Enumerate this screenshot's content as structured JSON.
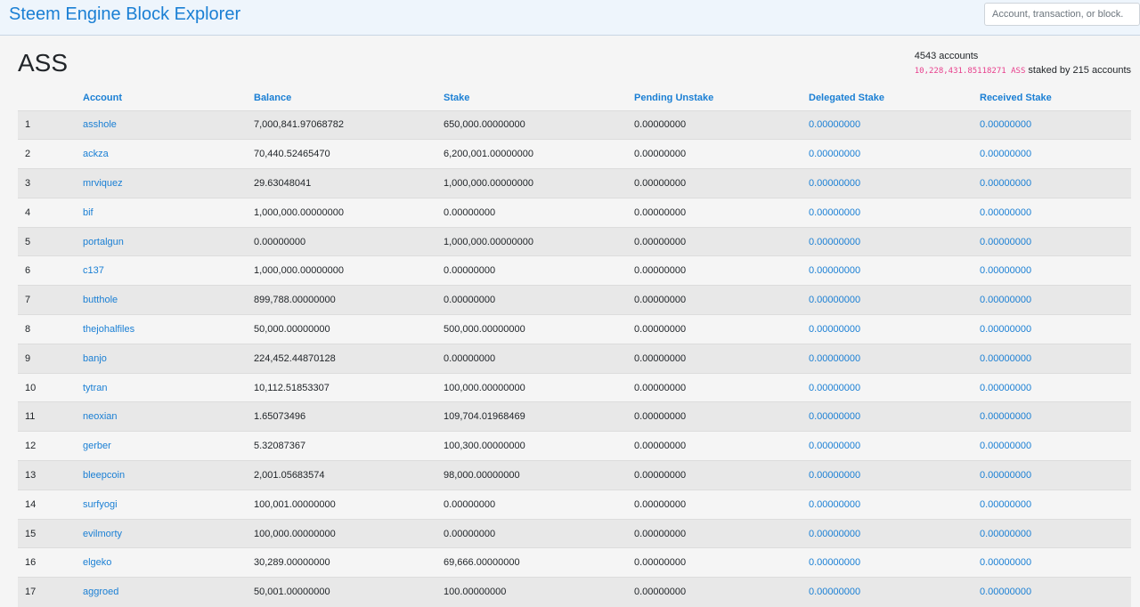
{
  "header": {
    "brand": "Steem Engine Block Explorer",
    "search_placeholder": "Account, transaction, or block."
  },
  "token": {
    "symbol": "ASS",
    "accounts_text": "4543 accounts",
    "staked_amount": "10,228,431.85118271 ASS",
    "staked_suffix": "staked by 215 accounts"
  },
  "colors": {
    "link": "#1a7fd4",
    "code": "#e83e8c"
  },
  "table": {
    "columns": [
      "",
      "Account",
      "Balance",
      "Stake",
      "Pending Unstake",
      "Delegated Stake",
      "Received Stake"
    ],
    "rows": [
      {
        "rank": "1",
        "account": "asshole",
        "balance": "7,000,841.97068782",
        "stake": "650,000.00000000",
        "pending": "0.00000000",
        "delegated": "0.00000000",
        "received": "0.00000000"
      },
      {
        "rank": "2",
        "account": "ackza",
        "balance": "70,440.52465470",
        "stake": "6,200,001.00000000",
        "pending": "0.00000000",
        "delegated": "0.00000000",
        "received": "0.00000000"
      },
      {
        "rank": "3",
        "account": "mrviquez",
        "balance": "29.63048041",
        "stake": "1,000,000.00000000",
        "pending": "0.00000000",
        "delegated": "0.00000000",
        "received": "0.00000000"
      },
      {
        "rank": "4",
        "account": "bif",
        "balance": "1,000,000.00000000",
        "stake": "0.00000000",
        "pending": "0.00000000",
        "delegated": "0.00000000",
        "received": "0.00000000"
      },
      {
        "rank": "5",
        "account": "portalgun",
        "balance": "0.00000000",
        "stake": "1,000,000.00000000",
        "pending": "0.00000000",
        "delegated": "0.00000000",
        "received": "0.00000000"
      },
      {
        "rank": "6",
        "account": "c137",
        "balance": "1,000,000.00000000",
        "stake": "0.00000000",
        "pending": "0.00000000",
        "delegated": "0.00000000",
        "received": "0.00000000"
      },
      {
        "rank": "7",
        "account": "butthole",
        "balance": "899,788.00000000",
        "stake": "0.00000000",
        "pending": "0.00000000",
        "delegated": "0.00000000",
        "received": "0.00000000"
      },
      {
        "rank": "8",
        "account": "thejohalfiles",
        "balance": "50,000.00000000",
        "stake": "500,000.00000000",
        "pending": "0.00000000",
        "delegated": "0.00000000",
        "received": "0.00000000"
      },
      {
        "rank": "9",
        "account": "banjo",
        "balance": "224,452.44870128",
        "stake": "0.00000000",
        "pending": "0.00000000",
        "delegated": "0.00000000",
        "received": "0.00000000"
      },
      {
        "rank": "10",
        "account": "tytran",
        "balance": "10,112.51853307",
        "stake": "100,000.00000000",
        "pending": "0.00000000",
        "delegated": "0.00000000",
        "received": "0.00000000"
      },
      {
        "rank": "11",
        "account": "neoxian",
        "balance": "1.65073496",
        "stake": "109,704.01968469",
        "pending": "0.00000000",
        "delegated": "0.00000000",
        "received": "0.00000000"
      },
      {
        "rank": "12",
        "account": "gerber",
        "balance": "5.32087367",
        "stake": "100,300.00000000",
        "pending": "0.00000000",
        "delegated": "0.00000000",
        "received": "0.00000000"
      },
      {
        "rank": "13",
        "account": "bleepcoin",
        "balance": "2,001.05683574",
        "stake": "98,000.00000000",
        "pending": "0.00000000",
        "delegated": "0.00000000",
        "received": "0.00000000"
      },
      {
        "rank": "14",
        "account": "surfyogi",
        "balance": "100,001.00000000",
        "stake": "0.00000000",
        "pending": "0.00000000",
        "delegated": "0.00000000",
        "received": "0.00000000"
      },
      {
        "rank": "15",
        "account": "evilmorty",
        "balance": "100,000.00000000",
        "stake": "0.00000000",
        "pending": "0.00000000",
        "delegated": "0.00000000",
        "received": "0.00000000"
      },
      {
        "rank": "16",
        "account": "elgeko",
        "balance": "30,289.00000000",
        "stake": "69,666.00000000",
        "pending": "0.00000000",
        "delegated": "0.00000000",
        "received": "0.00000000"
      },
      {
        "rank": "17",
        "account": "aggroed",
        "balance": "50,001.00000000",
        "stake": "100.00000000",
        "pending": "0.00000000",
        "delegated": "0.00000000",
        "received": "0.00000000"
      }
    ]
  }
}
